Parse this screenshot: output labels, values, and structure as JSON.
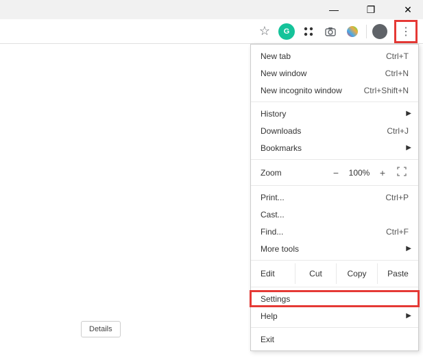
{
  "window": {
    "minimize": "—",
    "maximize": "❐",
    "close": "✕"
  },
  "toolbar": {
    "star": "☆",
    "grammarly": "G",
    "puzzle": "✖✖",
    "camera": "◉",
    "avatar": "●"
  },
  "menu": {
    "new_tab": {
      "label": "New tab",
      "shortcut": "Ctrl+T"
    },
    "new_window": {
      "label": "New window",
      "shortcut": "Ctrl+N"
    },
    "incognito": {
      "label": "New incognito window",
      "shortcut": "Ctrl+Shift+N"
    },
    "history": {
      "label": "History"
    },
    "downloads": {
      "label": "Downloads",
      "shortcut": "Ctrl+J"
    },
    "bookmarks": {
      "label": "Bookmarks"
    },
    "zoom": {
      "label": "Zoom",
      "minus": "−",
      "value": "100%",
      "plus": "+"
    },
    "print": {
      "label": "Print...",
      "shortcut": "Ctrl+P"
    },
    "cast": {
      "label": "Cast..."
    },
    "find": {
      "label": "Find...",
      "shortcut": "Ctrl+F"
    },
    "more_tools": {
      "label": "More tools"
    },
    "edit": {
      "label": "Edit",
      "cut": "Cut",
      "copy": "Copy",
      "paste": "Paste"
    },
    "settings": {
      "label": "Settings"
    },
    "help": {
      "label": "Help"
    },
    "exit": {
      "label": "Exit"
    }
  },
  "details_button": "Details"
}
